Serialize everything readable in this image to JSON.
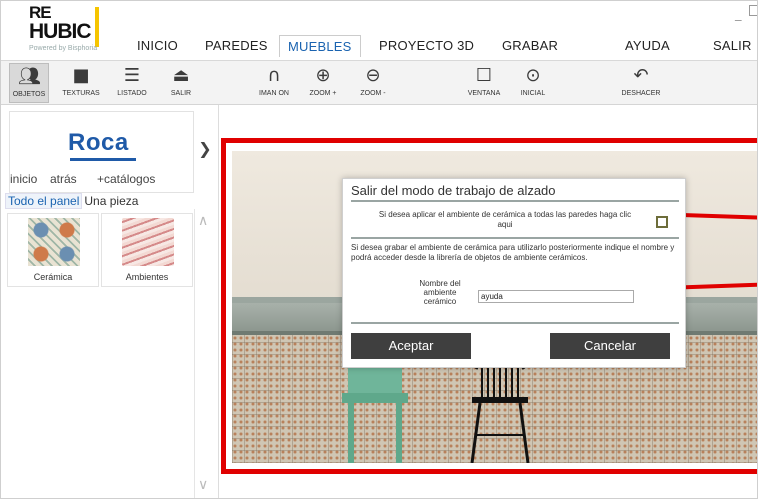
{
  "app": {
    "logo_re": "RE",
    "logo_name": "HUBIC",
    "logo_powered": "Powered by Bisphoria",
    "menu": {
      "inicio": "INICIO",
      "paredes": "PAREDES",
      "muebles": "MUEBLES",
      "proyecto": "PROYECTO 3D",
      "grabar": "GRABAR",
      "ayuda": "AYUDA",
      "salir": "SALIR"
    },
    "active_menu": "MUEBLES"
  },
  "toolbar": {
    "objetos": "OBJETOS",
    "texturas": "TEXTURAS",
    "listado": "LISTADO",
    "salir": "SALIR",
    "iman": "IMAN ON",
    "zoom_in": "ZOOM +",
    "zoom_out": "ZOOM -",
    "ventana": "VENTANA",
    "inicial": "INICIAL",
    "deshacer": "DESHACER"
  },
  "left_panel": {
    "brand": "Roca",
    "nav": {
      "inicio": "inicio",
      "atras": "atrás",
      "catalogos": "+catálogos"
    },
    "tabs": {
      "all": "Todo el panel",
      "one": "Una pieza"
    },
    "items": [
      {
        "label": "Cerámica"
      },
      {
        "label": "Ambientes"
      }
    ]
  },
  "dialog": {
    "title": "Salir del modo de trabajo de alzado",
    "apply_text_1": "Si desea aplicar el ambiente de cerámica a todas las paredes haga clic",
    "apply_text_2": "aqui",
    "save_text": "Si desea grabar el ambiente de cerámica para utilizarlo posteriormente indique el nombre y podrá acceder desde la librería de objetos de ambiente cerámicos.",
    "field_label": "Nombre del ambiente cerámico",
    "field_value": "ayuda",
    "accept": "Aceptar",
    "cancel": "Cancelar"
  },
  "colors": {
    "accent_blue": "#1a63b0",
    "highlight_red": "#e00000",
    "brand_yellow": "#f6c500",
    "dialog_button": "#3f3f3f"
  },
  "icons": {
    "objetos": "people-icon",
    "texturas": "cube-icon",
    "listado": "list-icon",
    "salir": "exit-icon",
    "iman": "magnet-icon",
    "zoom_in": "zoom-in-icon",
    "zoom_out": "zoom-out-icon",
    "ventana": "zoom-window-icon",
    "inicial": "zoom-initial-icon",
    "deshacer": "undo-icon"
  }
}
